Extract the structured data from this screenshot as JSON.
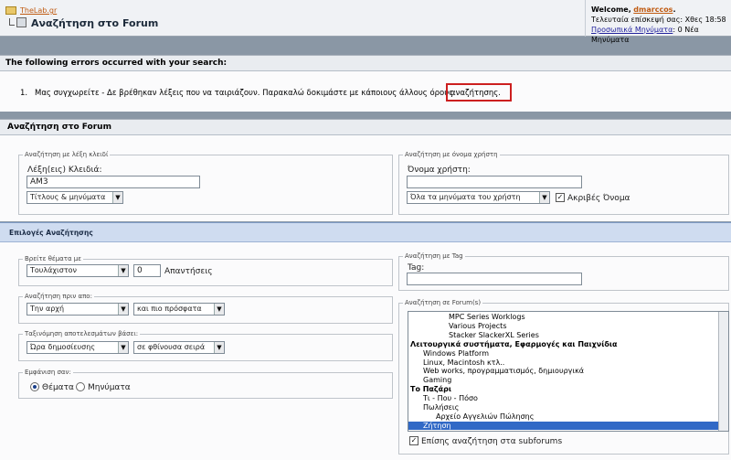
{
  "navbar": {
    "site_link": "TheLab.gr",
    "page_title": "Αναζήτηση στο Forum",
    "welcome_prefix": "Welcome,",
    "username": "dmarccos",
    "last_visit": "Τελευταία επίσκεψή σας: Χθες 18:58",
    "pm_link": "Προσωπικά Μηνύματα",
    "pm_count": ": 0 Νέα Μηνύματα"
  },
  "errors": {
    "header": "The following errors occurred with your search:",
    "item_number": "1.",
    "message": "Μας συγχωρείτε - Δε βρέθηκαν λέξεις που να ταιριάζουν. Παρακαλώ δοκιμάστε με κάποιους άλλους όρους",
    "highlight": "αναζήτησης."
  },
  "search_panel": {
    "title": "Αναζήτηση στο Forum",
    "keyword": {
      "legend": "Αναζήτηση με λέξη κλειδί",
      "label": "Λέξη(εις) Κλειδιά:",
      "value": "AM3",
      "scope": "Τίτλους & μηνύματα"
    },
    "user": {
      "legend": "Αναζήτηση με όνομα χρήστη",
      "label": "Όνομα χρήστη:",
      "value": "",
      "scope": "Όλα τα μηνύματα του χρήστη",
      "exact_label": "Ακριβές Όνομα",
      "exact_checked": true
    }
  },
  "options_panel": {
    "title": "Επιλογές Αναζήτησης",
    "threads": {
      "legend": "Βρείτε θέματα με",
      "mode": "Τουλάχιστον",
      "count": "0",
      "suffix": "Απαντήσεις"
    },
    "date": {
      "legend": "Αναζήτηση πριν απο:",
      "from": "Την αρχή",
      "direction": "και πιο πρόσφατα"
    },
    "sort": {
      "legend": "Ταξινόμηση αποτελεσμάτων βάσει:",
      "field": "Ώρα δημοσίευσης",
      "order": "σε φθίνουσα σειρά"
    },
    "display": {
      "legend": "Εμφάνιση σαν:",
      "threads": "Θέματα",
      "posts": "Μηνύματα",
      "selected": "threads"
    },
    "tag": {
      "legend": "Αναζήτηση με Tag",
      "label": "Tag:",
      "value": ""
    },
    "forums": {
      "legend": "Αναζήτηση σε Forum(s)",
      "items": [
        {
          "label": "MPC Series Worklogs",
          "level": 3,
          "bold": false,
          "selected": false
        },
        {
          "label": "Various Projects",
          "level": 3,
          "bold": false,
          "selected": false
        },
        {
          "label": "Stacker SlackerXL Series",
          "level": 3,
          "bold": false,
          "selected": false
        },
        {
          "label": "Λειτουργικά συστήματα, Εφαρμογές και Παιχνίδια",
          "level": 0,
          "bold": true,
          "selected": false
        },
        {
          "label": "Windows Platform",
          "level": 1,
          "bold": false,
          "selected": false
        },
        {
          "label": "Linux, Macintosh κτλ..",
          "level": 1,
          "bold": false,
          "selected": false
        },
        {
          "label": "Web works, προγραμματισμός, δημιουργικά",
          "level": 1,
          "bold": false,
          "selected": false
        },
        {
          "label": "Gaming",
          "level": 1,
          "bold": false,
          "selected": false
        },
        {
          "label": "Το Παζάρι",
          "level": 0,
          "bold": true,
          "selected": false
        },
        {
          "label": "Τι - Που - Πόσο",
          "level": 1,
          "bold": false,
          "selected": false
        },
        {
          "label": "Πωλήσεις",
          "level": 1,
          "bold": false,
          "selected": false
        },
        {
          "label": "Αρχείο Αγγελιών Πώλησης",
          "level": 2,
          "bold": false,
          "selected": false
        },
        {
          "label": "Ζήτηση",
          "level": 1,
          "bold": false,
          "selected": true
        }
      ],
      "subforums_label": "Επίσης αναζήτηση στα subforums",
      "subforums_checked": true
    }
  },
  "colors": {
    "background": "#8a97a5",
    "options_bar": "#cfdcf0",
    "selection": "#3169c6",
    "error_highlight": "#cc1f1f"
  }
}
